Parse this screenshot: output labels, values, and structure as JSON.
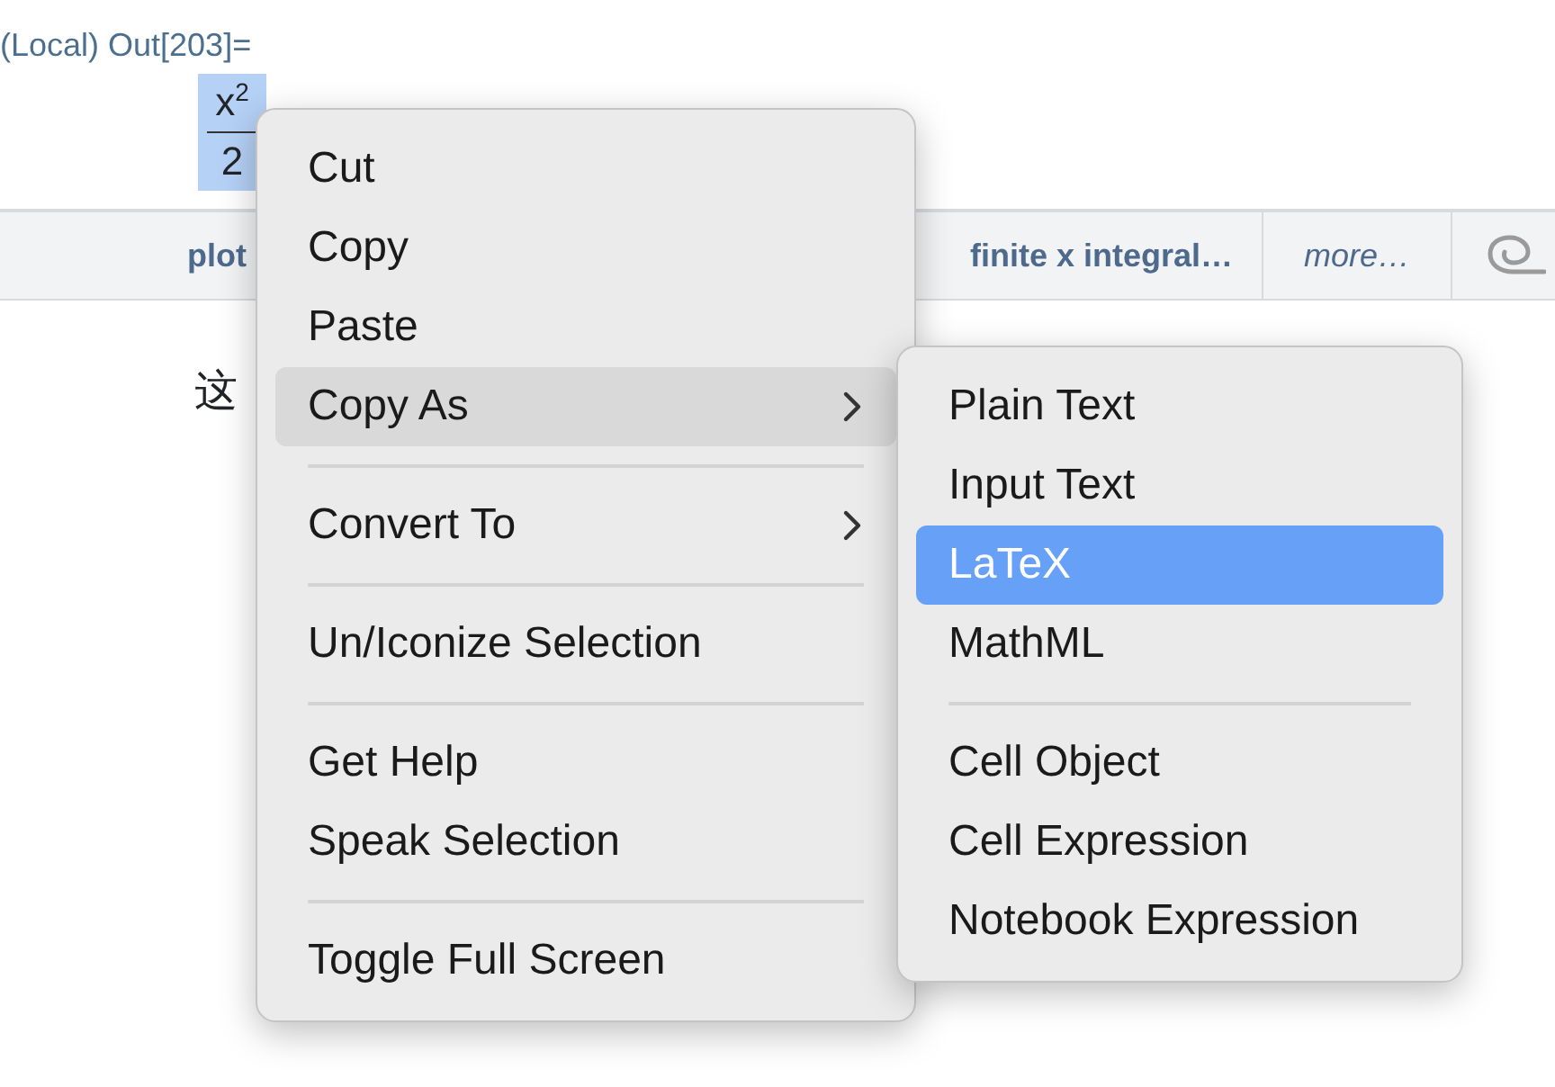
{
  "output": {
    "label": "(Local) Out[203]=",
    "numerator": "x$^{2}$",
    "denominator": "2",
    "selected": true
  },
  "suggestions": [
    {
      "label": "plot",
      "kind": "action"
    },
    {
      "label": "finite x integral…",
      "kind": "action"
    },
    {
      "label": "more…",
      "kind": "more"
    }
  ],
  "body_text": "这",
  "context_menu": [
    {
      "kind": "item",
      "label": "Cut",
      "submenu": false,
      "selected": false
    },
    {
      "kind": "item",
      "label": "Copy",
      "submenu": false,
      "selected": false
    },
    {
      "kind": "item",
      "label": "Paste",
      "submenu": false,
      "selected": false
    },
    {
      "kind": "item",
      "label": "Copy As",
      "submenu": true,
      "selected": true
    },
    {
      "kind": "separator"
    },
    {
      "kind": "item",
      "label": "Convert To",
      "submenu": true,
      "selected": false
    },
    {
      "kind": "separator"
    },
    {
      "kind": "item",
      "label": "Un/Iconize Selection",
      "submenu": false,
      "selected": false
    },
    {
      "kind": "separator"
    },
    {
      "kind": "item",
      "label": "Get Help",
      "submenu": false,
      "selected": false
    },
    {
      "kind": "item",
      "label": "Speak Selection",
      "submenu": false,
      "selected": false
    },
    {
      "kind": "separator"
    },
    {
      "kind": "item",
      "label": "Toggle Full Screen",
      "submenu": false,
      "selected": false
    }
  ],
  "submenu": [
    {
      "kind": "item",
      "label": "Plain Text",
      "selected": false
    },
    {
      "kind": "item",
      "label": "Input Text",
      "selected": false
    },
    {
      "kind": "item",
      "label": "LaTeX",
      "selected": true
    },
    {
      "kind": "item",
      "label": "MathML",
      "selected": false
    },
    {
      "kind": "separator"
    },
    {
      "kind": "item",
      "label": "Cell Object",
      "selected": false
    },
    {
      "kind": "item",
      "label": "Cell Expression",
      "selected": false
    },
    {
      "kind": "item",
      "label": "Notebook Expression",
      "selected": false
    }
  ]
}
